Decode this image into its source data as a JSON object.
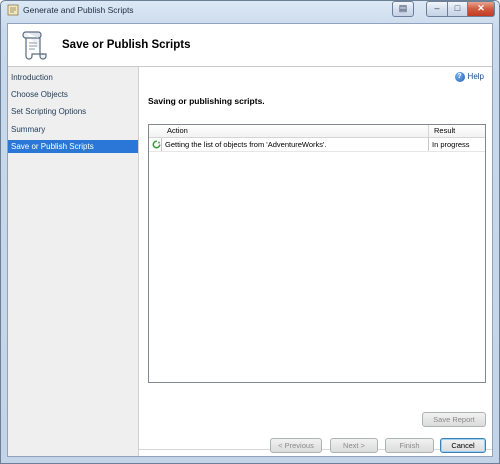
{
  "window": {
    "title": "Generate and Publish Scripts"
  },
  "header": {
    "title": "Save or Publish Scripts"
  },
  "sidebar": {
    "items": [
      {
        "label": "Introduction",
        "selected": false
      },
      {
        "label": "Choose Objects",
        "selected": false
      },
      {
        "label": "Set Scripting Options",
        "selected": false
      },
      {
        "label": "Summary",
        "selected": false
      },
      {
        "label": "Save or Publish Scripts",
        "selected": true
      }
    ]
  },
  "main": {
    "help_label": "Help",
    "section_title": "Saving or publishing scripts.",
    "grid": {
      "columns": {
        "action": "Action",
        "result": "Result"
      },
      "rows": [
        {
          "action": "Getting the list of objects from 'AdventureWorks'.",
          "result": "In progress",
          "status_icon": "in-progress-icon"
        }
      ]
    },
    "save_report_label": "Save Report"
  },
  "footer": {
    "previous_label": "< Previous",
    "next_label": "Next >",
    "finish_label": "Finish",
    "cancel_label": "Cancel"
  },
  "colors": {
    "selection": "#2b77d8",
    "accent": "#1d5fb8",
    "in_progress": "#2f9a2f"
  }
}
